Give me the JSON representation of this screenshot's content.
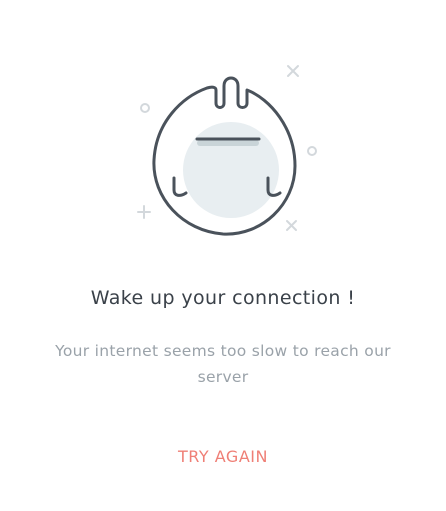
{
  "error": {
    "title": "Wake up your connection !",
    "message": "Your internet seems too slow to reach our server",
    "retry_label": "TRY AGAIN"
  },
  "illustration": {
    "icon": "sleepy-robot-head-icon",
    "decorations": [
      "circle-icon",
      "cross-icon",
      "plus-icon"
    ]
  },
  "colors": {
    "title": "#3a4149",
    "message": "#9aa2a9",
    "accent": "#ef7f76",
    "outline": "#4a525b",
    "fill": "#e8eef1",
    "decoration": "#d3d8dc"
  }
}
